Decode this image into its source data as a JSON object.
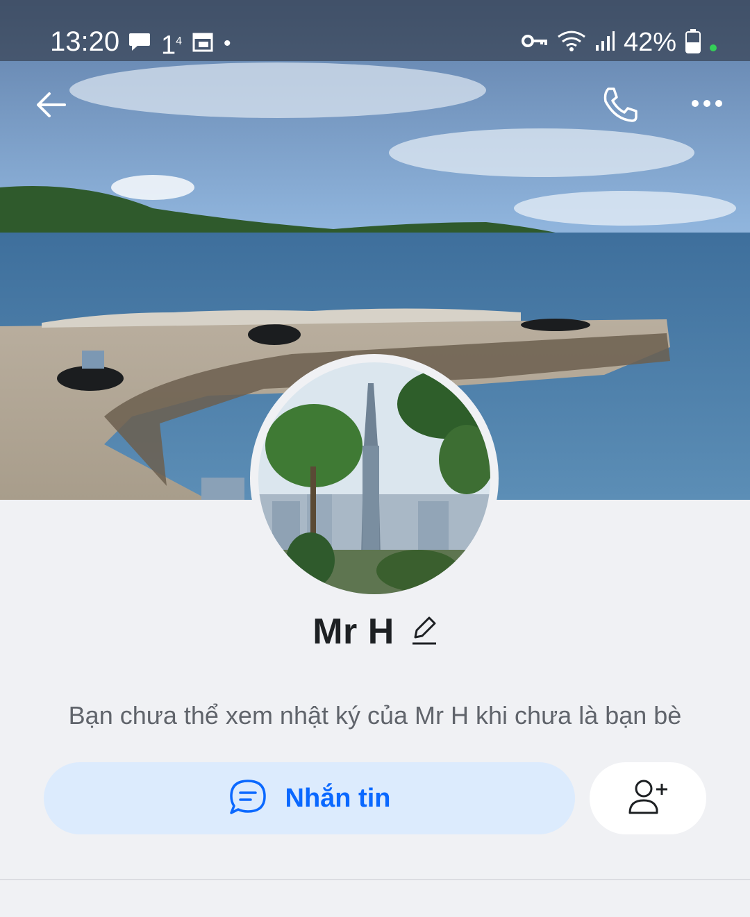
{
  "status_bar": {
    "time": "13:20",
    "notification_badge": "1",
    "notification_badge_sup": "4",
    "dot": "•",
    "battery_percent": "42%",
    "icons": [
      "chat-bubble-icon",
      "calendar-icon",
      "key-icon",
      "wifi-icon",
      "signal-icon",
      "battery-icon"
    ]
  },
  "header": {
    "icons": [
      "back-arrow-icon",
      "phone-icon",
      "more-options-icon"
    ]
  },
  "profile": {
    "name": "Mr H",
    "notice": "Bạn chưa thể xem nhật ký của Mr H khi chưa là bạn bè"
  },
  "actions": {
    "message_label": "Nhắn tin",
    "icons": [
      "chat-icon",
      "add-friend-icon"
    ]
  },
  "colors": {
    "accent": "#0a68ff",
    "message_button_bg": "#dcebfd",
    "page_bg": "#f0f1f4"
  }
}
